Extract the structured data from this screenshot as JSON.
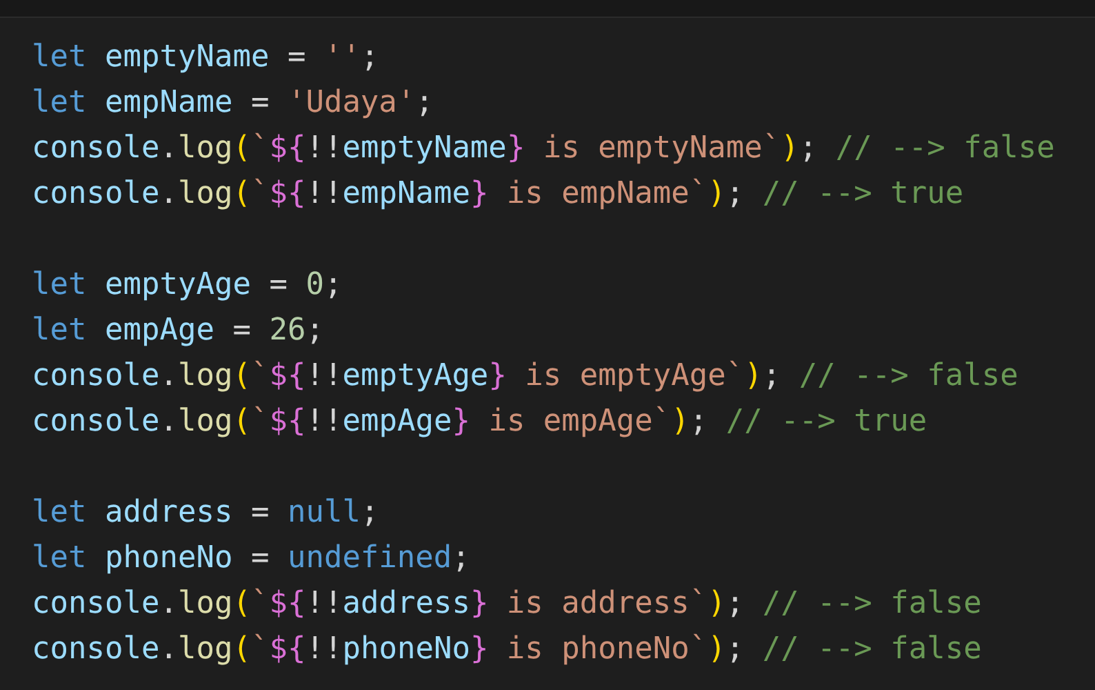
{
  "editor": {
    "lines": [
      {
        "kind": "code",
        "tokens": [
          {
            "kind": "kw",
            "text": "let "
          },
          {
            "kind": "var",
            "text": "emptyName"
          },
          {
            "kind": "plain",
            "text": " = "
          },
          {
            "kind": "str",
            "text": "''"
          },
          {
            "kind": "plain",
            "text": ";"
          }
        ]
      },
      {
        "kind": "code",
        "tokens": [
          {
            "kind": "kw",
            "text": "let "
          },
          {
            "kind": "var",
            "text": "empName"
          },
          {
            "kind": "plain",
            "text": " = "
          },
          {
            "kind": "str",
            "text": "'Udaya'"
          },
          {
            "kind": "plain",
            "text": ";"
          }
        ]
      },
      {
        "kind": "code",
        "tokens": [
          {
            "kind": "var",
            "text": "console"
          },
          {
            "kind": "plain",
            "text": "."
          },
          {
            "kind": "fn",
            "text": "log"
          },
          {
            "kind": "paren",
            "text": "("
          },
          {
            "kind": "str",
            "text": "`"
          },
          {
            "kind": "interp",
            "text": "${"
          },
          {
            "kind": "plain",
            "text": "!!"
          },
          {
            "kind": "var",
            "text": "emptyName"
          },
          {
            "kind": "interp",
            "text": "}"
          },
          {
            "kind": "str",
            "text": " is emptyName`"
          },
          {
            "kind": "paren",
            "text": ")"
          },
          {
            "kind": "plain",
            "text": "; "
          },
          {
            "kind": "comment",
            "text": "// --> false"
          }
        ]
      },
      {
        "kind": "code",
        "tokens": [
          {
            "kind": "var",
            "text": "console"
          },
          {
            "kind": "plain",
            "text": "."
          },
          {
            "kind": "fn",
            "text": "log"
          },
          {
            "kind": "paren",
            "text": "("
          },
          {
            "kind": "str",
            "text": "`"
          },
          {
            "kind": "interp",
            "text": "${"
          },
          {
            "kind": "plain",
            "text": "!!"
          },
          {
            "kind": "var",
            "text": "empName"
          },
          {
            "kind": "interp",
            "text": "}"
          },
          {
            "kind": "str",
            "text": " is empName`"
          },
          {
            "kind": "paren",
            "text": ")"
          },
          {
            "kind": "plain",
            "text": "; "
          },
          {
            "kind": "comment",
            "text": "// --> true"
          }
        ]
      },
      {
        "kind": "blank"
      },
      {
        "kind": "code",
        "tokens": [
          {
            "kind": "kw",
            "text": "let "
          },
          {
            "kind": "var",
            "text": "emptyAge"
          },
          {
            "kind": "plain",
            "text": " = "
          },
          {
            "kind": "num",
            "text": "0"
          },
          {
            "kind": "plain",
            "text": ";"
          }
        ]
      },
      {
        "kind": "code",
        "tokens": [
          {
            "kind": "kw",
            "text": "let "
          },
          {
            "kind": "var",
            "text": "empAge"
          },
          {
            "kind": "plain",
            "text": " = "
          },
          {
            "kind": "num",
            "text": "26"
          },
          {
            "kind": "plain",
            "text": ";"
          }
        ]
      },
      {
        "kind": "code",
        "tokens": [
          {
            "kind": "var",
            "text": "console"
          },
          {
            "kind": "plain",
            "text": "."
          },
          {
            "kind": "fn",
            "text": "log"
          },
          {
            "kind": "paren",
            "text": "("
          },
          {
            "kind": "str",
            "text": "`"
          },
          {
            "kind": "interp",
            "text": "${"
          },
          {
            "kind": "plain",
            "text": "!!"
          },
          {
            "kind": "var",
            "text": "emptyAge"
          },
          {
            "kind": "interp",
            "text": "}"
          },
          {
            "kind": "str",
            "text": " is emptyAge`"
          },
          {
            "kind": "paren",
            "text": ")"
          },
          {
            "kind": "plain",
            "text": "; "
          },
          {
            "kind": "comment",
            "text": "// --> false"
          }
        ]
      },
      {
        "kind": "code",
        "tokens": [
          {
            "kind": "var",
            "text": "console"
          },
          {
            "kind": "plain",
            "text": "."
          },
          {
            "kind": "fn",
            "text": "log"
          },
          {
            "kind": "paren",
            "text": "("
          },
          {
            "kind": "str",
            "text": "`"
          },
          {
            "kind": "interp",
            "text": "${"
          },
          {
            "kind": "plain",
            "text": "!!"
          },
          {
            "kind": "var",
            "text": "empAge"
          },
          {
            "kind": "interp",
            "text": "}"
          },
          {
            "kind": "str",
            "text": " is empAge`"
          },
          {
            "kind": "paren",
            "text": ")"
          },
          {
            "kind": "plain",
            "text": "; "
          },
          {
            "kind": "comment",
            "text": "// --> true"
          }
        ]
      },
      {
        "kind": "blank"
      },
      {
        "kind": "code",
        "tokens": [
          {
            "kind": "kw",
            "text": "let "
          },
          {
            "kind": "var",
            "text": "address"
          },
          {
            "kind": "plain",
            "text": " = "
          },
          {
            "kind": "kw",
            "text": "null"
          },
          {
            "kind": "plain",
            "text": ";"
          }
        ]
      },
      {
        "kind": "code",
        "tokens": [
          {
            "kind": "kw",
            "text": "let "
          },
          {
            "kind": "var",
            "text": "phoneNo"
          },
          {
            "kind": "plain",
            "text": " = "
          },
          {
            "kind": "kw",
            "text": "undefined"
          },
          {
            "kind": "plain",
            "text": ";"
          }
        ]
      },
      {
        "kind": "code",
        "tokens": [
          {
            "kind": "var",
            "text": "console"
          },
          {
            "kind": "plain",
            "text": "."
          },
          {
            "kind": "fn",
            "text": "log"
          },
          {
            "kind": "paren",
            "text": "("
          },
          {
            "kind": "str",
            "text": "`"
          },
          {
            "kind": "interp",
            "text": "${"
          },
          {
            "kind": "plain",
            "text": "!!"
          },
          {
            "kind": "var",
            "text": "address"
          },
          {
            "kind": "interp",
            "text": "}"
          },
          {
            "kind": "str",
            "text": " is address`"
          },
          {
            "kind": "paren",
            "text": ")"
          },
          {
            "kind": "plain",
            "text": "; "
          },
          {
            "kind": "comment",
            "text": "// --> false"
          }
        ]
      },
      {
        "kind": "code",
        "tokens": [
          {
            "kind": "var",
            "text": "console"
          },
          {
            "kind": "plain",
            "text": "."
          },
          {
            "kind": "fn",
            "text": "log"
          },
          {
            "kind": "paren",
            "text": "("
          },
          {
            "kind": "str",
            "text": "`"
          },
          {
            "kind": "interp",
            "text": "${"
          },
          {
            "kind": "plain",
            "text": "!!"
          },
          {
            "kind": "var",
            "text": "phoneNo"
          },
          {
            "kind": "interp",
            "text": "}"
          },
          {
            "kind": "str",
            "text": " is phoneNo`"
          },
          {
            "kind": "paren",
            "text": ")"
          },
          {
            "kind": "plain",
            "text": "; "
          },
          {
            "kind": "comment",
            "text": "// --> false"
          }
        ]
      }
    ]
  }
}
